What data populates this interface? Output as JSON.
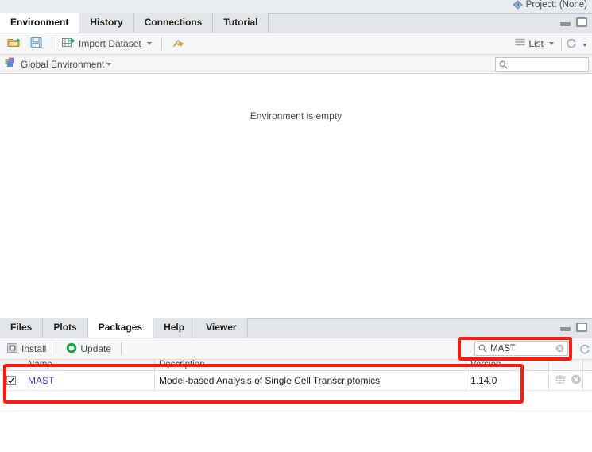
{
  "topbar": {
    "project_label": "Project: (None)",
    "project_icon": "r-project-icon"
  },
  "environment_pane": {
    "tabs": [
      {
        "label": "Environment",
        "active": true
      },
      {
        "label": "History",
        "active": false
      },
      {
        "label": "Connections",
        "active": false
      },
      {
        "label": "Tutorial",
        "active": false
      }
    ],
    "toolbar": {
      "open_icon": "open-folder-icon",
      "save_icon": "save-disk-icon",
      "import_icon": "import-dataset-icon",
      "import_label": "Import Dataset",
      "broom_icon": "broom-icon",
      "list_icon": "list-view-icon",
      "list_label": "List",
      "refresh_icon": "refresh-icon"
    },
    "scope": {
      "icon": "global-environment-icon",
      "label": "Global Environment"
    },
    "search": {
      "value": "",
      "placeholder": "",
      "icon": "search-icon"
    },
    "empty_message": "Environment is empty",
    "controls": {
      "minimize": "minimize-pane-icon",
      "maximize": "maximize-pane-icon"
    }
  },
  "packages_pane": {
    "tabs": [
      {
        "label": "Files",
        "active": false
      },
      {
        "label": "Plots",
        "active": false
      },
      {
        "label": "Packages",
        "active": true
      },
      {
        "label": "Help",
        "active": false
      },
      {
        "label": "Viewer",
        "active": false
      }
    ],
    "toolbar": {
      "install_icon": "install-icon",
      "install_label": "Install",
      "update_icon": "update-icon",
      "update_label": "Update",
      "refresh_icon": "refresh-icon"
    },
    "search": {
      "value": "MAST",
      "placeholder": "",
      "icon": "search-icon",
      "clear_icon": "clear-icon"
    },
    "columns": [
      "Name",
      "Description",
      "Version"
    ],
    "rows": [
      {
        "checked": true,
        "name": "MAST",
        "description": "Model-based Analysis of Single Cell Transcriptomics",
        "version": "1.14.0",
        "browse_icon": "globe-icon",
        "remove_icon": "remove-package-icon"
      }
    ],
    "controls": {
      "minimize": "minimize-pane-icon",
      "maximize": "maximize-pane-icon"
    }
  },
  "annotations": {
    "accent_color": "#ff1d10",
    "boxes": [
      {
        "name": "search-field-highlight"
      },
      {
        "name": "package-row-highlight"
      }
    ]
  }
}
